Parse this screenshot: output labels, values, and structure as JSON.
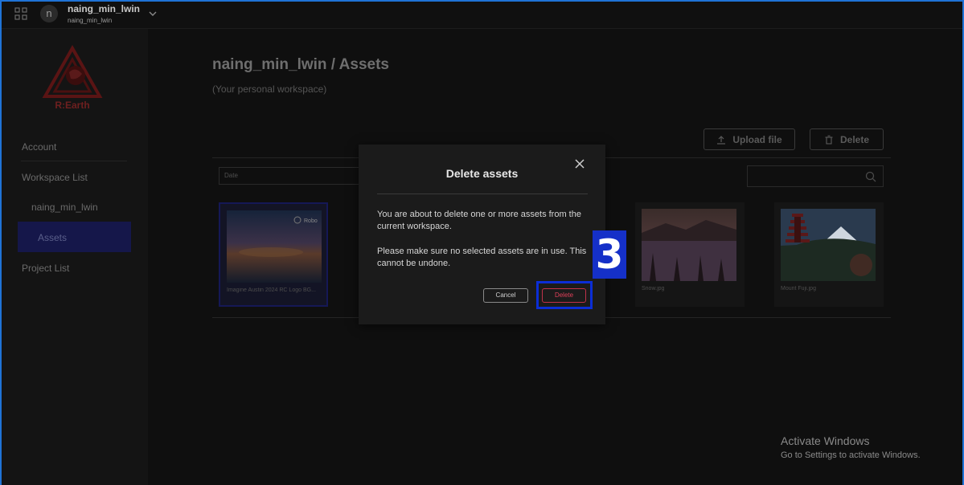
{
  "topbar": {
    "avatar_letter": "n",
    "workspace_name": "naing_min_lwin",
    "workspace_sub": "naing_min_lwin"
  },
  "sidebar": {
    "logo_text": "R:Earth",
    "items": [
      {
        "label": "Account"
      },
      {
        "label": "Workspace List"
      },
      {
        "label": "naing_min_lwin"
      },
      {
        "label": "Assets"
      },
      {
        "label": "Project List"
      }
    ]
  },
  "main": {
    "title": "naing_min_lwin / Assets",
    "subtitle": "(Your personal workspace)",
    "upload_label": "Upload file",
    "delete_label": "Delete",
    "date_placeholder": "Date",
    "assets": [
      {
        "name": "Imagine Austin 2024 RC Logo BG...",
        "thumb_text": "Robo"
      },
      {
        "name": "Snow.jpg"
      },
      {
        "name": "Mount Fuji.jpg"
      }
    ]
  },
  "modal": {
    "title": "Delete assets",
    "paragraph1": "You are about to delete one or more assets from the current workspace.",
    "paragraph2": "Please make sure no selected assets are in use. This cannot be undone.",
    "cancel_label": "Cancel",
    "delete_label": "Delete"
  },
  "annotation": {
    "step_number": "3"
  },
  "watermark": {
    "title": "Activate Windows",
    "subtitle": "Go to Settings to activate Windows."
  },
  "colors": {
    "highlight": "#0b2ed6",
    "delete_red": "#e0405a",
    "active_nav": "#15174a"
  }
}
